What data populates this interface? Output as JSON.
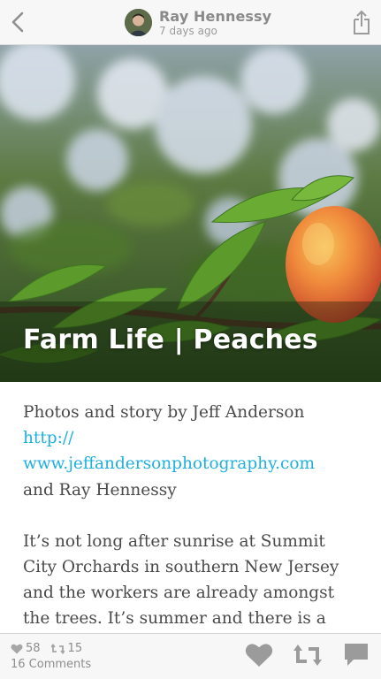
{
  "header": {
    "author_name": "Ray Hennessy",
    "post_time": "7 days ago"
  },
  "hero": {
    "title": "Farm Life | Peaches"
  },
  "article": {
    "intro_line": "Photos and story by Jeff Anderson",
    "link_line1": "http://",
    "link_line2": "www.jeffandersonphotography.com",
    "intro_end": "and Ray Hennessy",
    "body_paragraph": "It’s not long after sunrise at Summit City Orchards in southern New Jersey and the workers are already amongst the trees. It’s summer and there is a"
  },
  "footer": {
    "likes_count": "58",
    "reposts_count": "15",
    "comments_label": "16 Comments"
  },
  "colors": {
    "link": "#1fb0e0",
    "icon_gray": "#9b9b9b",
    "header_bg": "#f7f7f7"
  },
  "icons": [
    "chevron-left-icon",
    "share-icon",
    "heart-icon",
    "repost-icon",
    "comment-icon"
  ]
}
